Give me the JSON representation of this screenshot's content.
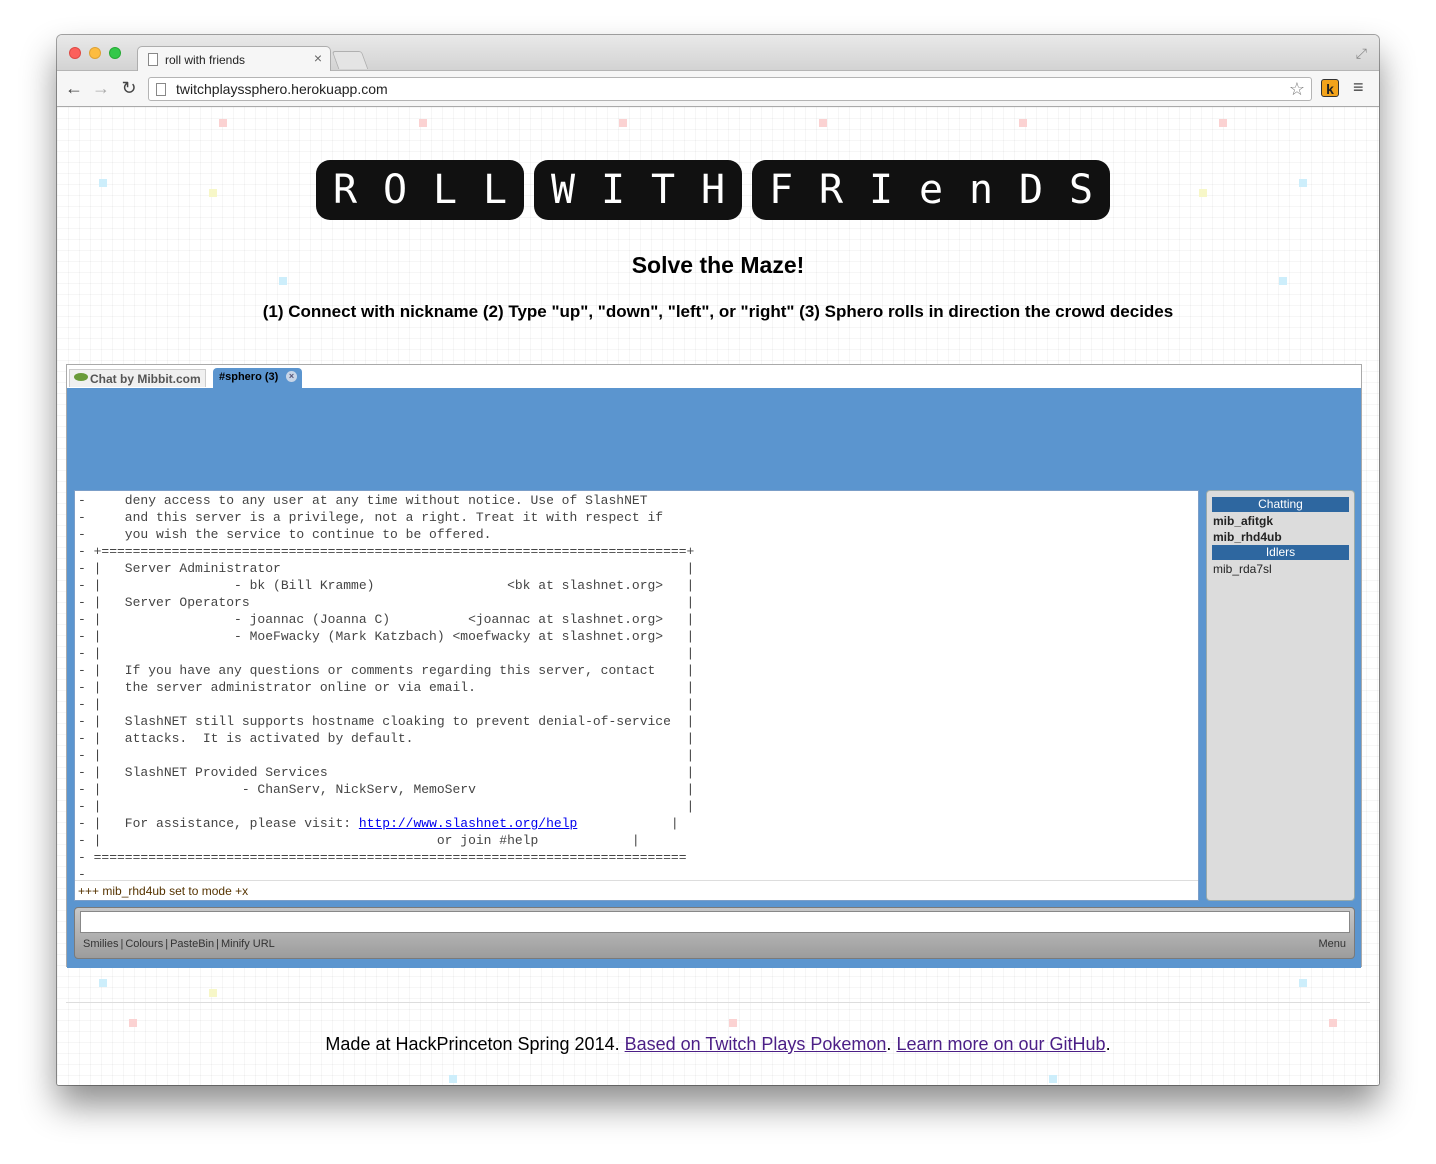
{
  "browser": {
    "tab_title": "roll with friends",
    "tab_close": "×",
    "url": "twitchplayssphero.herokuapp.com",
    "back": "←",
    "forward": "→",
    "reload": "↻",
    "star": "☆",
    "extension_label": "k",
    "menu": "≡",
    "resize": "⤢"
  },
  "page": {
    "logo_words": [
      [
        "R",
        "O",
        "L",
        "L"
      ],
      [
        "W",
        "I",
        "T",
        "H"
      ],
      [
        "F",
        "R",
        "I",
        "e",
        "n",
        "D",
        "S"
      ]
    ],
    "subtitle": "Solve the Maze!",
    "instructions": "(1) Connect with nickname (2) Type \"up\", \"down\", \"left\", or \"right\" (3) Sphero rolls in direction the crowd decides"
  },
  "chat": {
    "brand_tab": "Chat by Mibbit.com",
    "channel_tab": "#sphero (3)",
    "channel_close": "×",
    "motd_lines": [
      "-     deny access to any user at any time without notice. Use of SlashNET",
      "-     and this server is a privilege, not a right. Treat it with respect if",
      "-     you wish the service to continue to be offered.",
      "- +===========================================================================+",
      "- |   Server Administrator                                                    |",
      "- |                 - bk (Bill Kramme)                 <bk at slashnet.org>   |",
      "- |   Server Operators                                                        |",
      "- |                 - joannac (Joanna C)          <joannac at slashnet.org>   |",
      "- |                 - MoeFwacky (Mark Katzbach) <moefwacky at slashnet.org>   |",
      "- |                                                                           |",
      "- |   If you have any questions or comments regarding this server, contact    |",
      "- |   the server administrator online or via email.                           |",
      "- |                                                                           |",
      "- |   SlashNET still supports hostname cloaking to prevent denial-of-service  |",
      "- |   attacks.  It is activated by default.                                   |",
      "- |                                                                           |",
      "- |   SlashNET Provided Services                                              |",
      "- |                  - ChanServ, NickServ, MemoServ                           |"
    ],
    "motd_blank": "- |                                                                           |",
    "assist_prefix": "- |   For assistance, please visit: ",
    "assist_link": "http://www.slashnet.org/help",
    "assist_suffix": "            |",
    "join_line": "- |                                           or join #help            |",
    "close_line": "- ============================================================================",
    "dash_line": "-",
    "status": "+++ mib_rhd4ub set to mode +x",
    "userlist": {
      "chatting_label": "Chatting",
      "chatting": [
        "mib_afitgk",
        "mib_rhd4ub"
      ],
      "idlers_label": "Idlers",
      "idlers": [
        "mib_rda7sl"
      ]
    },
    "input_value": "",
    "links": [
      "Smilies",
      "Colours",
      "PasteBin",
      "Minify URL"
    ],
    "link_sep": "|",
    "menu_label": "Menu"
  },
  "footer": {
    "prefix": "Made at HackPrinceton Spring 2014.",
    "link1": "Based on Twitch Plays Pokemon",
    "sep": ".",
    "link2": "Learn more on our GitHub",
    "end": "."
  },
  "colors": {
    "accent_blue": "#5b95cf",
    "userlist_header": "#2e67a0",
    "footer_link": "#4b1e86",
    "logo_black": "#111111"
  }
}
